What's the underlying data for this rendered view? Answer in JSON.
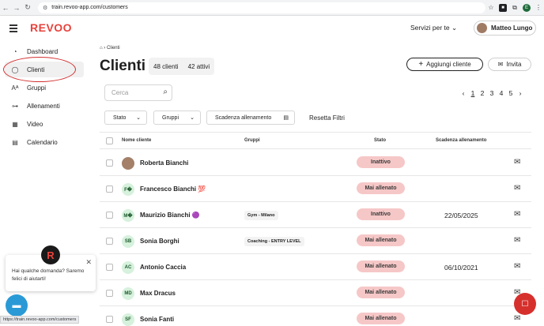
{
  "browser": {
    "url": "train.revoo-app.com/customers",
    "profile_initial": "E",
    "status_url": "https://train.revoo-app.com/customers"
  },
  "header": {
    "logo": "REVOO",
    "services": "Servizi per te",
    "user_name": "Matteo Lungo"
  },
  "sidebar": {
    "items": [
      {
        "label": "Dashboard",
        "icon": "gauge-icon"
      },
      {
        "label": "Clienti",
        "icon": "user-icon"
      },
      {
        "label": "Gruppi",
        "icon": "group-icon"
      },
      {
        "label": "Allenamenti",
        "icon": "dumbbell-icon"
      },
      {
        "label": "Video",
        "icon": "film-icon"
      },
      {
        "label": "Calendario",
        "icon": "calendar-icon"
      }
    ]
  },
  "breadcrumb": {
    "current": "Clienti"
  },
  "page": {
    "title": "Clienti",
    "total": "48 clienti",
    "active": "42 attivi",
    "add_button": "Aggiungi cliente",
    "invite_button": "Invita"
  },
  "search": {
    "placeholder": "Cerca"
  },
  "pagination": {
    "pages": [
      "1",
      "2",
      "3",
      "4",
      "5"
    ],
    "current": "1"
  },
  "filters": {
    "stato": "Stato",
    "gruppi": "Gruppi",
    "scadenza": "Scadenza allenamento",
    "reset": "Resetta Filtri"
  },
  "table": {
    "headers": {
      "name": "Nome cliente",
      "groups": "Gruppi",
      "status": "Stato",
      "expiry": "Scadenza allenamento"
    },
    "rows": [
      {
        "initials": "",
        "name": "Roberta Bianchi",
        "group": "",
        "status": "Inattivo",
        "date": ""
      },
      {
        "initials": "F�",
        "name": "Francesco Bianchi 💯",
        "group": "",
        "status": "Mai allenato",
        "date": ""
      },
      {
        "initials": "M�",
        "name": "Maurizio Bianchi 🟣",
        "group": "Gym - Milano",
        "status": "Inattivo",
        "date": "22/05/2025"
      },
      {
        "initials": "SB",
        "name": "Sonia Borghi",
        "group": "Coaching - ENTRY LEVEL",
        "status": "Mai allenato",
        "date": ""
      },
      {
        "initials": "AC",
        "name": "Antonio Caccia",
        "group": "",
        "status": "Mai allenato",
        "date": "06/10/2021"
      },
      {
        "initials": "MD",
        "name": "Max Dracus",
        "group": "",
        "status": "Mai allenato",
        "date": ""
      },
      {
        "initials": "SF",
        "name": "Sonia Fanti",
        "group": "",
        "status": "Mai allenato",
        "date": ""
      }
    ]
  },
  "chat": {
    "logo_letter": "R",
    "message": "Hai qualche domanda? Saremo felici di aiutarti!"
  },
  "colors": {
    "brand": "#e8423c",
    "status_bg": "#f6c7c7",
    "chat_blue": "#2a9ad6"
  }
}
